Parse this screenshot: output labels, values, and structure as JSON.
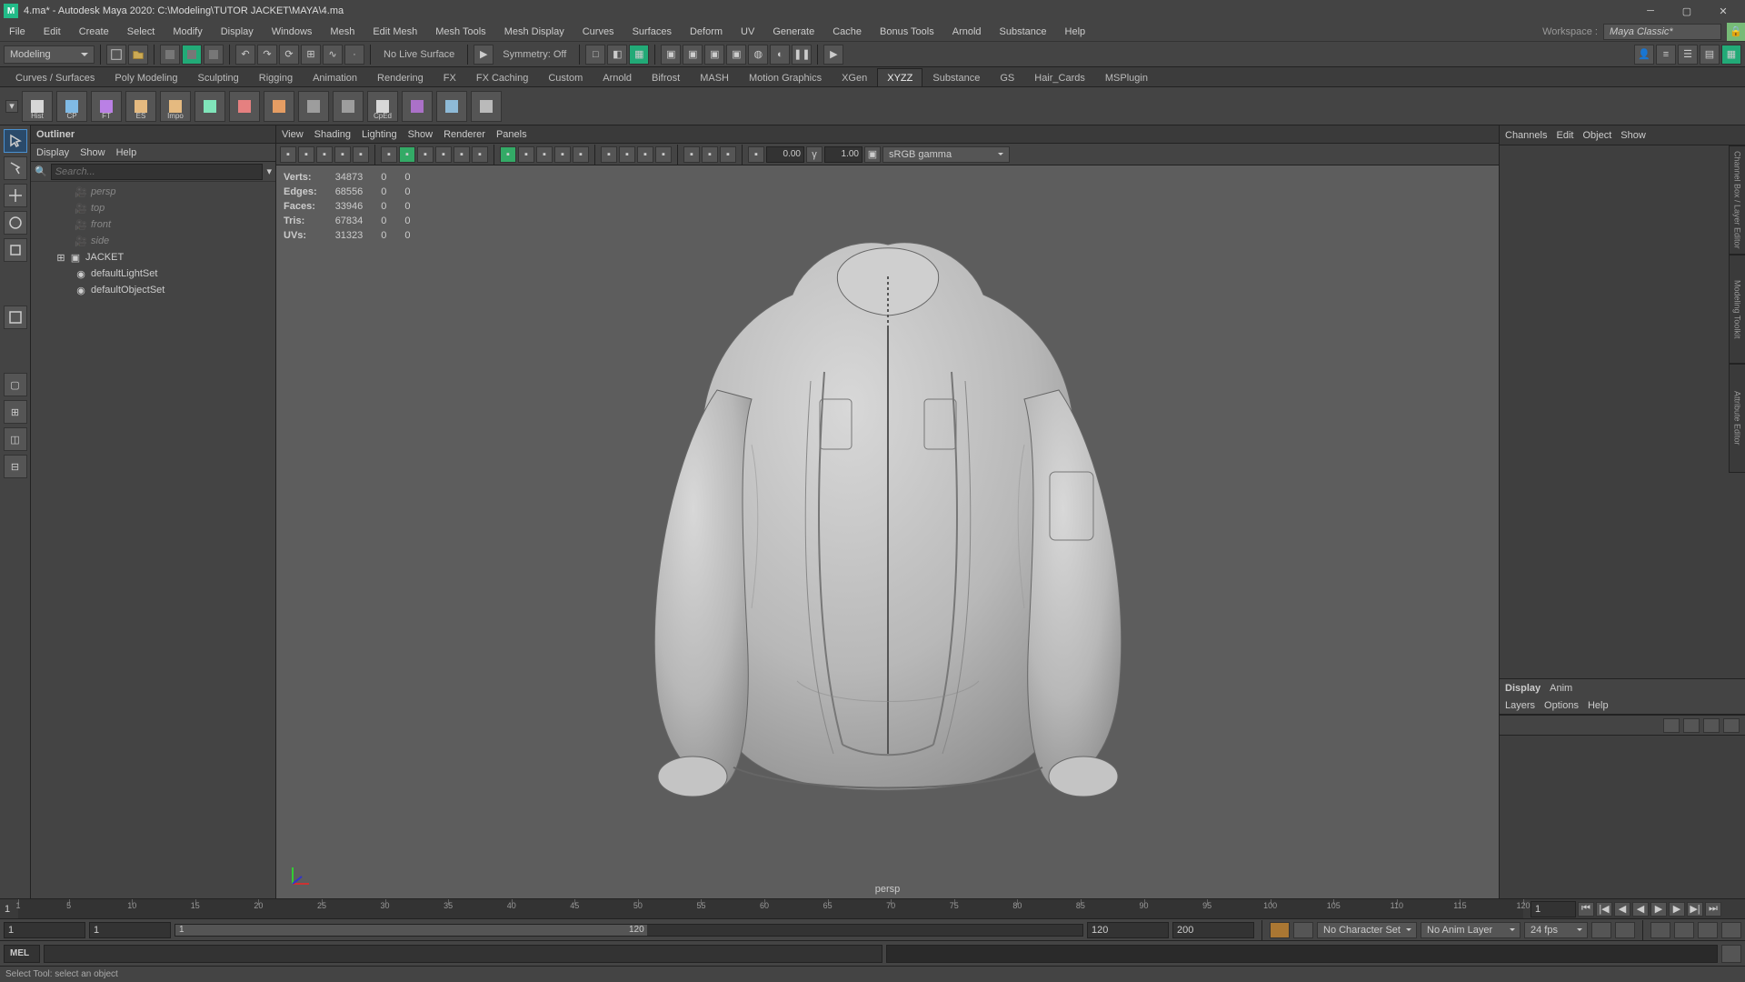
{
  "title": "4.ma* - Autodesk Maya 2020: C:\\Modeling\\TUTOR JACKET\\MAYA\\4.ma",
  "menubar": [
    "File",
    "Edit",
    "Create",
    "Select",
    "Modify",
    "Display",
    "Windows",
    "Mesh",
    "Edit Mesh",
    "Mesh Tools",
    "Mesh Display",
    "Curves",
    "Surfaces",
    "Deform",
    "UV",
    "Generate",
    "Cache",
    "Bonus Tools",
    "Arnold",
    "Substance",
    "Help"
  ],
  "workspace_label": "Workspace :",
  "workspace_value": "Maya Classic*",
  "status": {
    "menuset": "Modeling",
    "live_surface": "No Live Surface",
    "symmetry": "Symmetry: Off"
  },
  "shelf_tabs": [
    "Curves / Surfaces",
    "Poly Modeling",
    "Sculpting",
    "Rigging",
    "Animation",
    "Rendering",
    "FX",
    "FX Caching",
    "Custom",
    "Arnold",
    "Bifrost",
    "MASH",
    "Motion Graphics",
    "XGen",
    "XYZZ",
    "Substance",
    "GS",
    "Hair_Cards",
    "MSPlugin"
  ],
  "shelf_active": "XYZZ",
  "shelf_icons": [
    "Hist",
    "CP",
    "FT",
    "ES",
    "Impo",
    "",
    "",
    "",
    "",
    "",
    "CpEd",
    "",
    "",
    ""
  ],
  "outliner": {
    "title": "Outliner",
    "menu": [
      "Display",
      "Show",
      "Help"
    ],
    "search_placeholder": "Search...",
    "cameras": [
      "persp",
      "top",
      "front",
      "side"
    ],
    "nodes": [
      "JACKET",
      "defaultLightSet",
      "defaultObjectSet"
    ]
  },
  "viewport": {
    "menu": [
      "View",
      "Shading",
      "Lighting",
      "Show",
      "Renderer",
      "Panels"
    ],
    "gamma": "sRGB gamma",
    "exposure": "0.00",
    "gammaval": "1.00",
    "label": "persp",
    "stats": {
      "rows": [
        [
          "Verts:",
          "34873",
          "0",
          "0"
        ],
        [
          "Edges:",
          "68556",
          "0",
          "0"
        ],
        [
          "Faces:",
          "33946",
          "0",
          "0"
        ],
        [
          "Tris:",
          "67834",
          "0",
          "0"
        ],
        [
          "UVs:",
          "31323",
          "0",
          "0"
        ]
      ]
    }
  },
  "channelbox": {
    "tabs": [
      "Channels",
      "Edit",
      "Object",
      "Show"
    ],
    "layer_tabs": [
      "Display",
      "Anim"
    ],
    "layer_menu": [
      "Layers",
      "Options",
      "Help"
    ]
  },
  "side_tabs": [
    "Channel Box / Layer Editor",
    "Modeling Toolkit",
    "Attribute Editor"
  ],
  "timeline": {
    "start": 1,
    "end": 120,
    "range_end": 200,
    "ticks": [
      1,
      5,
      10,
      15,
      20,
      25,
      30,
      35,
      40,
      45,
      50,
      55,
      60,
      65,
      70,
      75,
      80,
      85,
      90,
      95,
      100,
      105,
      110,
      115,
      120
    ],
    "cur": 1
  },
  "range": {
    "start": "1",
    "inner_start": "1",
    "inner_start2": "1",
    "inner_end": "120",
    "end": "120",
    "range_end": "200",
    "charset": "No Character Set",
    "animlayer": "No Anim Layer",
    "fps": "24 fps"
  },
  "cmd_label": "MEL",
  "helpline": "Select Tool: select an object"
}
